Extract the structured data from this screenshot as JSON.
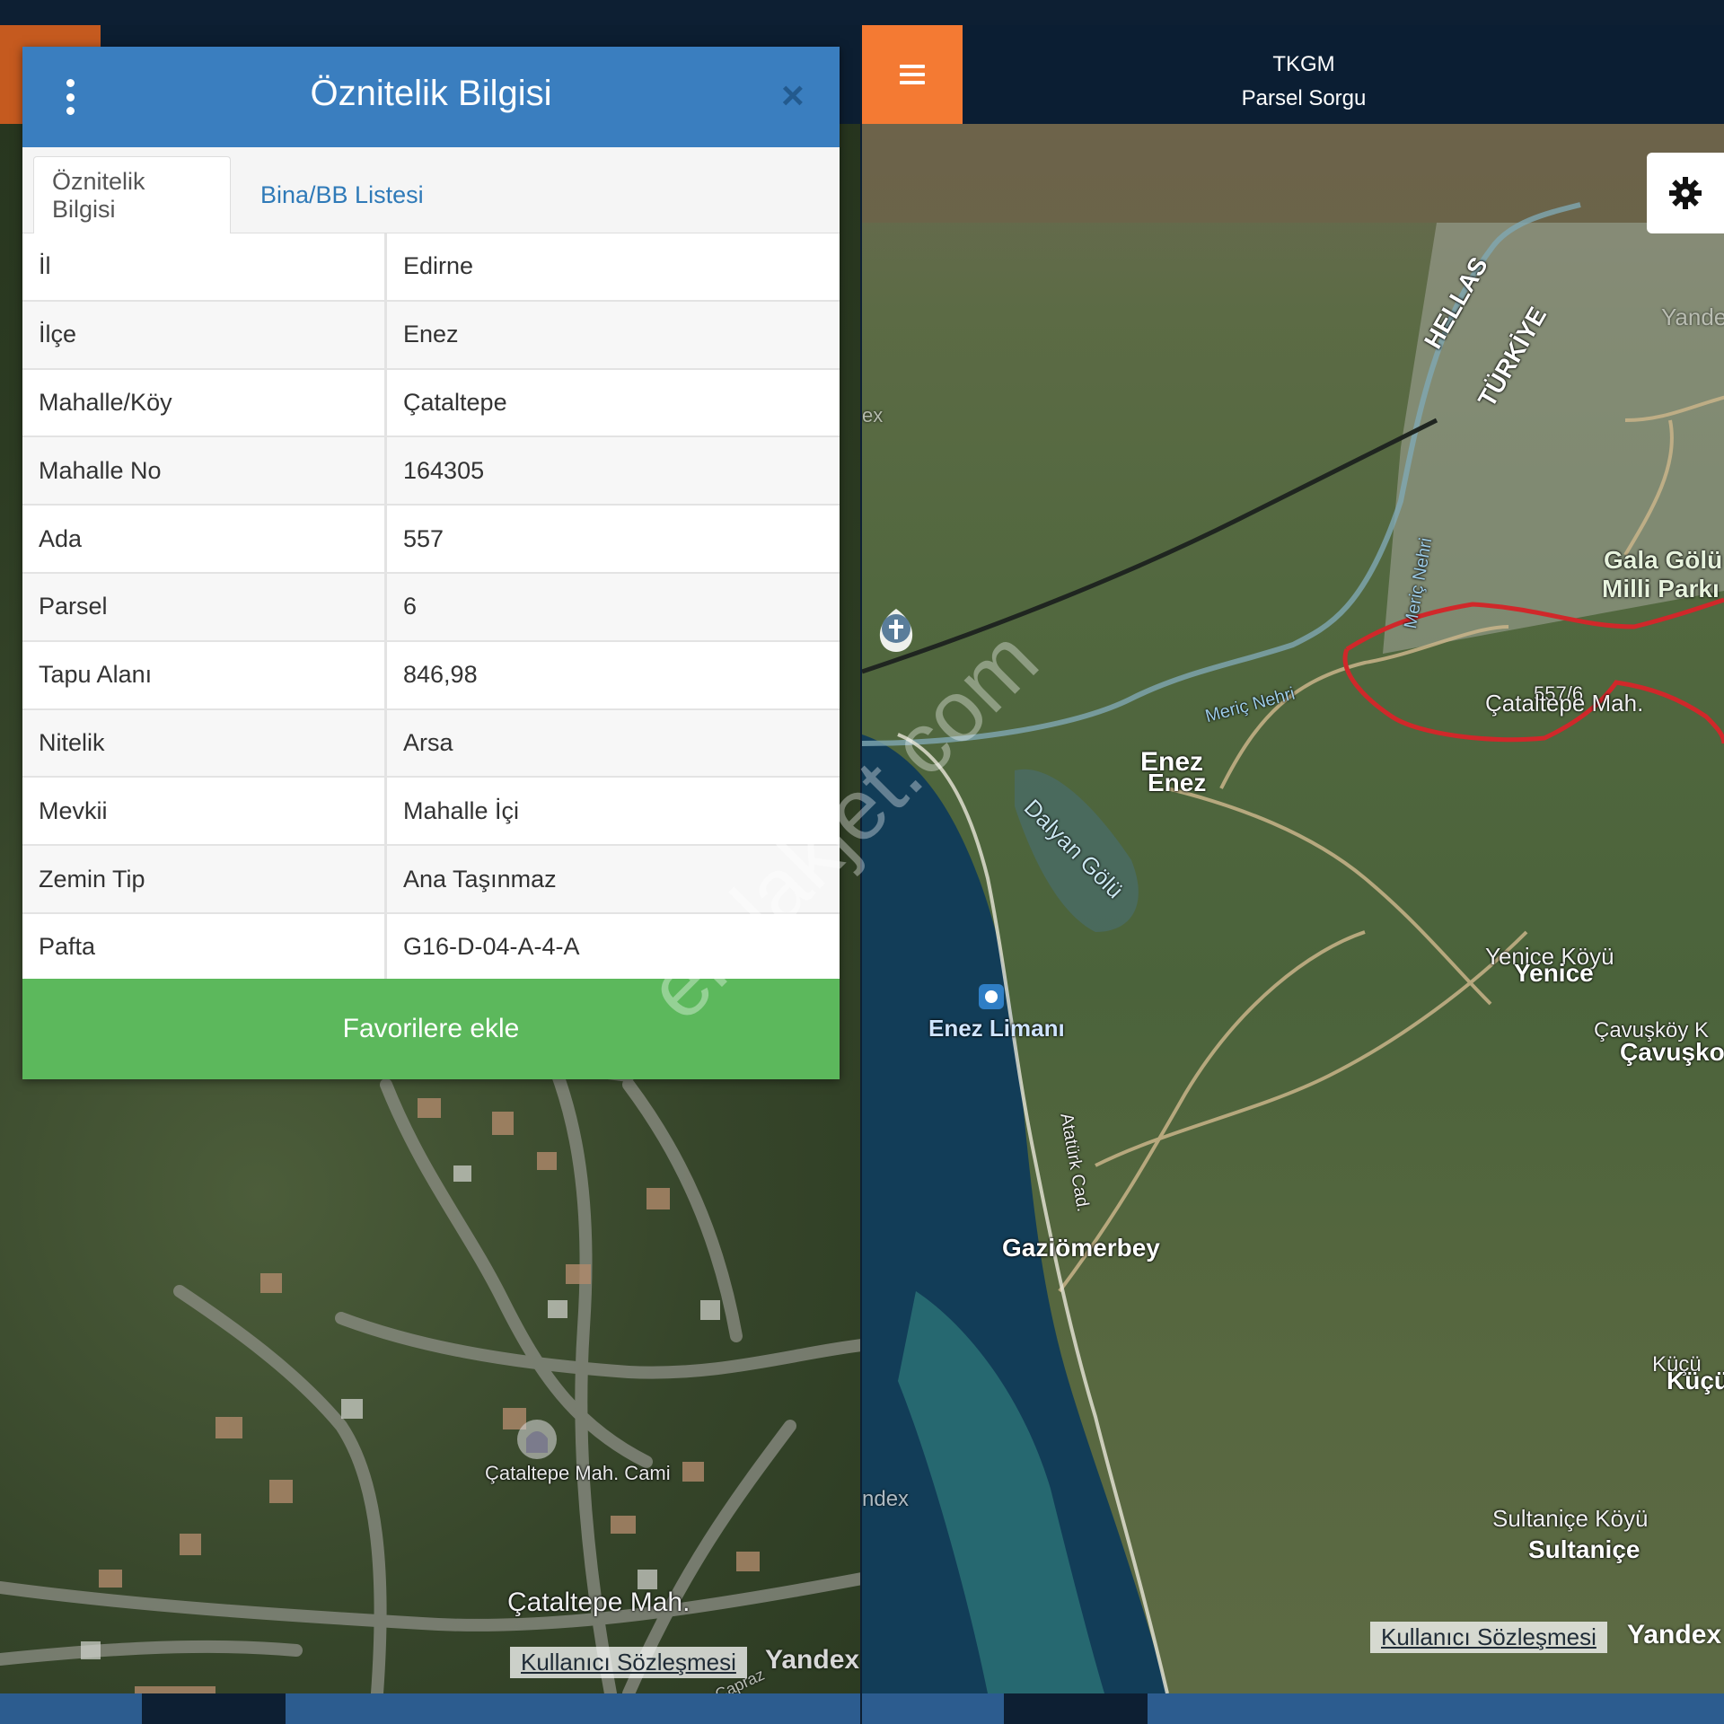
{
  "left_panel": {
    "map_labels": {
      "mosque": "Çataltepe Mah. Cami",
      "mahalle": "Çataltepe Mah.",
      "road": "Çapraz"
    },
    "attribution": "Kullanıcı Sözleşmesi",
    "brand": "Yandex"
  },
  "modal": {
    "title": "Öznitelik Bilgisi",
    "close_glyph": "×",
    "tabs": [
      {
        "label": "Öznitelik Bilgisi",
        "active": true
      },
      {
        "label": "Bina/BB Listesi",
        "active": false
      }
    ],
    "rows": [
      {
        "key": "İl",
        "value": "Edirne"
      },
      {
        "key": "İlçe",
        "value": "Enez"
      },
      {
        "key": "Mahalle/Köy",
        "value": "Çataltepe"
      },
      {
        "key": "Mahalle No",
        "value": "164305"
      },
      {
        "key": "Ada",
        "value": "557"
      },
      {
        "key": "Parsel",
        "value": "6"
      },
      {
        "key": "Tapu Alanı",
        "value": "846,98"
      },
      {
        "key": "Nitelik",
        "value": "Arsa"
      },
      {
        "key": "Mevkii",
        "value": "Mahalle İçi"
      },
      {
        "key": "Zemin Tip",
        "value": "Ana Taşınmaz"
      },
      {
        "key": "Pafta",
        "value": "G16-D-04-A-4-A"
      }
    ],
    "favorite_button": "Favorilere ekle"
  },
  "right_panel": {
    "header": {
      "line1": "TKGM",
      "line2": "Parsel Sorgu"
    },
    "map_labels": {
      "hellas": "HELLAS",
      "turkiye": "TÜRKİYE",
      "meric1": "Meriç Nehri",
      "meric2": "Meriç Nehri",
      "gala": "Gala Gölü",
      "milli": "Milli Parkı",
      "parcel_no": "557/6",
      "parcel_mah": "Çataltepe Mah.",
      "enez1": "Enez",
      "enez2": "Enez",
      "dalyan": "Dalyan Gölü",
      "yenice_koyu": "Yenice Köyü",
      "yenice": "Yenice",
      "enez_limani": "Enez Limanı",
      "cavuskoy_k": "Çavuşköy K",
      "cavusko": "Çavuşko",
      "ataturk": "Atatürk Cad.",
      "gaziomerbey": "Gaziömerbey",
      "kucuk_k": "Küçü",
      "kucuk": "Küçü",
      "sultanice_koyu": "Sultaniçe Köyü",
      "sultanice": "Sultaniçe",
      "yandex_faint": "Yandex",
      "ex_frag": "ex",
      "ndex_frag": "ndex"
    },
    "attribution": "Kullanıcı Sözleşmesi",
    "brand": "Yandex"
  },
  "watermark": "emlakjet.com",
  "colors": {
    "modal_header": "#3a7ebf",
    "favorite_button": "#5cb85c",
    "menu_button": "#f47a33",
    "parcel_outline": "#d0282a",
    "header_dark": "#0b1e33"
  },
  "icons": [
    "kebab-menu-icon",
    "close-icon",
    "hamburger-menu-icon",
    "gear-icon",
    "church-pin-icon",
    "harbor-icon",
    "mosque-icon"
  ]
}
